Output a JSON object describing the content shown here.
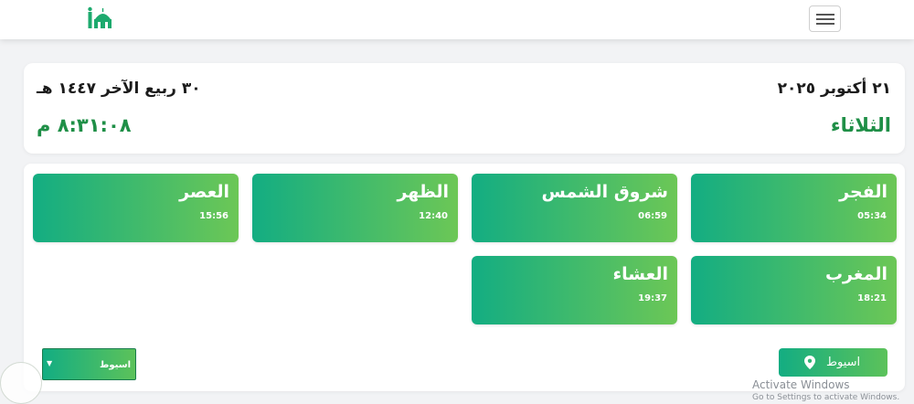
{
  "header": {
    "logo_icon": "mosque-icon",
    "menu_icon": "hamburger-menu-icon"
  },
  "date_card": {
    "gregorian_date": "٢١ أكتوبر ٢٠٢٥",
    "hijri_date": "٣٠ ربيع الآخر ١٤٤٧ هـ",
    "day_name": "الثلاثاء",
    "clock": "٨:٣١:٠٨ م",
    "accent_color": "#1f8f47"
  },
  "prayers": [
    {
      "name": "الفجر",
      "time": "05:34"
    },
    {
      "name": "شروق الشمس",
      "time": "06:59"
    },
    {
      "name": "الظهر",
      "time": "12:40"
    },
    {
      "name": "العصر",
      "time": "15:56"
    },
    {
      "name": "المغرب",
      "time": "18:21"
    },
    {
      "name": "العشاء",
      "time": "19:37"
    }
  ],
  "controls": {
    "location_button_label": "اسيوط",
    "location_button_icon": "map-pin-icon",
    "location_select_value": "اسيوط"
  },
  "watermark": {
    "line1": "Activate Windows",
    "line2": "Go to Settings to activate Windows."
  },
  "colors": {
    "gradient_start": "#13ad82",
    "gradient_end": "#6cc756"
  }
}
